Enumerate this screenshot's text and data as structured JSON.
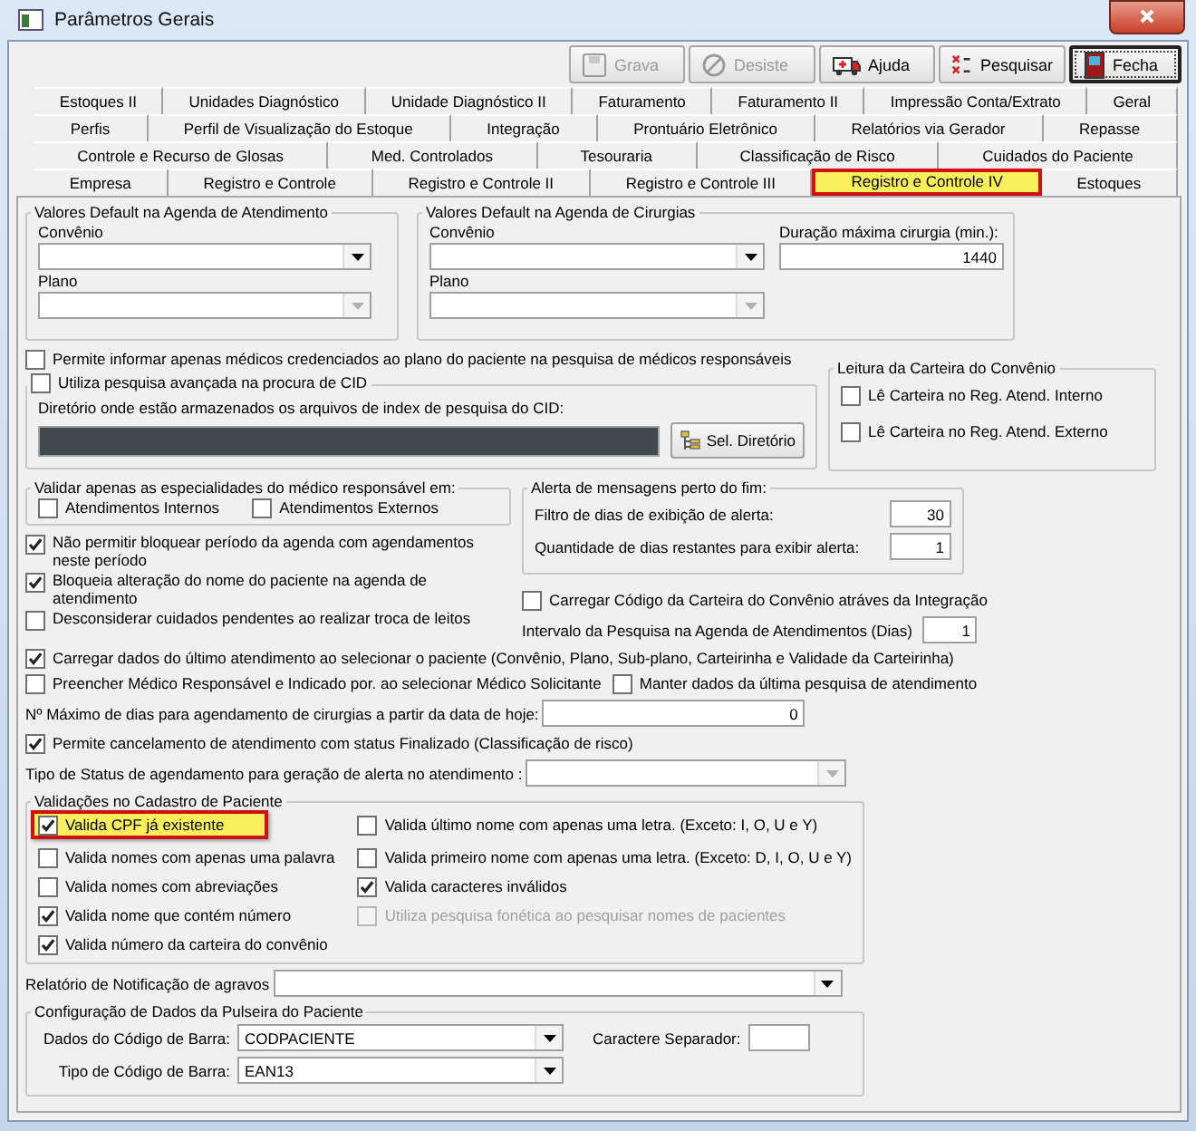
{
  "window": {
    "title": "Parâmetros Gerais"
  },
  "toolbar": [
    {
      "label": "Grava",
      "kind": "save",
      "disabled": true,
      "focused": false
    },
    {
      "label": "Desiste",
      "kind": "cancel",
      "disabled": true,
      "focused": false
    },
    {
      "label": "Ajuda",
      "kind": "help",
      "disabled": false,
      "focused": false
    },
    {
      "label": "Pesquisar",
      "kind": "search",
      "disabled": false,
      "focused": false
    },
    {
      "label": "Fecha",
      "kind": "close",
      "disabled": false,
      "focused": true
    }
  ],
  "tab_rows": [
    [
      {
        "label": "Estoques II",
        "selected": false
      },
      {
        "label": "Unidades Diagnóstico",
        "selected": false
      },
      {
        "label": "Unidade Diagnóstico II",
        "selected": false
      },
      {
        "label": "Faturamento",
        "selected": false
      },
      {
        "label": "Faturamento II",
        "selected": false
      },
      {
        "label": "Impressão Conta/Extrato",
        "selected": false
      },
      {
        "label": "Geral",
        "selected": false
      }
    ],
    [
      {
        "label": "Perfis",
        "selected": false
      },
      {
        "label": "Perfil de Visualização do Estoque",
        "selected": false
      },
      {
        "label": "Integração",
        "selected": false
      },
      {
        "label": "Prontuário Eletrônico",
        "selected": false
      },
      {
        "label": "Relatórios via Gerador",
        "selected": false
      },
      {
        "label": "Repasse",
        "selected": false
      }
    ],
    [
      {
        "label": "Controle e Recurso de Glosas",
        "selected": false
      },
      {
        "label": "Med. Controlados",
        "selected": false
      },
      {
        "label": "Tesouraria",
        "selected": false
      },
      {
        "label": "Classificação de Risco",
        "selected": false
      },
      {
        "label": "Cuidados do Paciente",
        "selected": false
      }
    ],
    [
      {
        "label": "Empresa",
        "selected": false
      },
      {
        "label": "Registro e Controle",
        "selected": false
      },
      {
        "label": "Registro e Controle II",
        "selected": false
      },
      {
        "label": "Registro e Controle III",
        "selected": false
      },
      {
        "label": "Registro e Controle IV",
        "selected": true
      },
      {
        "label": "Estoques",
        "selected": false
      }
    ]
  ],
  "atendimento_defaults": {
    "title": "Valores Default na Agenda de Atendimento",
    "convenio": {
      "label": "Convênio",
      "disabled": false
    },
    "plano": {
      "label": "Plano",
      "disabled": true
    }
  },
  "cirurgias_defaults": {
    "title": "Valores Default na Agenda de Cirurgias",
    "convenio": {
      "label": "Convênio",
      "disabled": false
    },
    "plano": {
      "label": "Plano",
      "disabled": true
    },
    "duracao": {
      "label": "Duração máxima cirurgia (min.):",
      "value": "1440"
    }
  },
  "permite_informar": {
    "label": "Permite informar apenas médicos credenciados ao plano do paciente na pesquisa de médicos responsáveis",
    "checked": false
  },
  "cid": {
    "title": {
      "label": "Utiliza pesquisa avançada na procura de CID",
      "checked": false
    },
    "directory_label": "Diretório onde estão armazenados os arquivos de index de pesquisa do CID:",
    "button": "Sel. Diretório"
  },
  "leitura_carteira": {
    "title": "Leitura da Carteira do Convênio",
    "options": [
      {
        "label": "Lê Carteira no Reg. Atend. Interno",
        "checked": false
      },
      {
        "label": "Lê Carteira no Reg. Atend. Externo",
        "checked": false
      }
    ]
  },
  "validar_especialidades": {
    "title": "Validar apenas as especialidades do médico responsável em:",
    "options": [
      {
        "label": "Atendimentos Internos",
        "checked": false
      },
      {
        "label": "Atendimentos Externos",
        "checked": false
      }
    ]
  },
  "left_options": [
    {
      "label": "Não permitir bloquear período da agenda com agendamentos neste período",
      "checked": true
    },
    {
      "label": "Bloqueia alteração do nome do paciente na agenda de atendimento",
      "checked": true
    },
    {
      "label": "Desconsiderar cuidados pendentes ao realizar troca de leitos",
      "checked": false
    }
  ],
  "alerta": {
    "title": "Alerta de mensagens perto do fim:",
    "fields": [
      {
        "label": "Filtro de dias de exibição de alerta:",
        "value": "30"
      },
      {
        "label": "Quantidade de dias restantes para exibir alerta:",
        "value": "1"
      }
    ]
  },
  "carregar_codigo": {
    "label": "Carregar Código da Carteira do Convênio atráves da Integração",
    "checked": false
  },
  "intervalo": {
    "label": "Intervalo da Pesquisa na Agenda de Atendimentos (Dias)",
    "value": "1"
  },
  "carregar_dados": {
    "label": "Carregar dados do último atendimento ao selecionar o paciente (Convênio, Plano, Sub-plano, Carteirinha e Validade da Carteirinha)",
    "checked": true
  },
  "preencher": {
    "label": "Preencher Médico Responsável e Indicado por. ao selecionar Médico Solicitante",
    "checked": false
  },
  "manter": {
    "label": "Manter dados da última pesquisa de atendimento",
    "checked": false
  },
  "max_dias": {
    "label": "Nº Máximo de dias para agendamento de cirurgias a partir da data de hoje:",
    "value": "0"
  },
  "permite_cancelamento": {
    "label": "Permite cancelamento de atendimento com status Finalizado (Classificação de risco)",
    "checked": true
  },
  "tipo_status": {
    "label": "Tipo de Status de agendamento para geração de alerta no atendimento :",
    "disabled": true
  },
  "validacoes": {
    "title": "Validações no Cadastro de Paciente",
    "columns": [
      [
        {
          "label": "Valida CPF já existente",
          "checked": true,
          "disabled": false,
          "highlighted": true
        },
        {
          "label": "Valida nomes com apenas uma palavra",
          "checked": false,
          "disabled": false,
          "highlighted": false
        },
        {
          "label": "Valida nomes com abreviações",
          "checked": false,
          "disabled": false,
          "highlighted": false
        },
        {
          "label": "Valida nome que contém número",
          "checked": true,
          "disabled": false,
          "highlighted": false
        },
        {
          "label": "Valida número da carteira do convênio",
          "checked": true,
          "disabled": false,
          "highlighted": false
        }
      ],
      [
        {
          "label": "Valida último nome com apenas uma letra. (Exceto: I, O, U e Y)",
          "checked": false,
          "disabled": false,
          "highlighted": false
        },
        {
          "label": "Valida primeiro nome com apenas uma letra. (Exceto: D, I, O, U e Y)",
          "checked": false,
          "disabled": false,
          "highlighted": false
        },
        {
          "label": "Valida caracteres inválidos",
          "checked": true,
          "disabled": false,
          "highlighted": false
        },
        {
          "label": "Utiliza pesquisa fonética ao pesquisar nomes de pacientes",
          "checked": false,
          "disabled": true,
          "highlighted": false
        }
      ]
    ]
  },
  "relatorio": {
    "label": "Relatório de Notificação de agravos",
    "disabled": false
  },
  "pulseira": {
    "title": "Configuração de Dados da Pulseira do Paciente",
    "dados": {
      "label": "Dados do Código de Barra:",
      "value": "CODPACIENTE"
    },
    "separador": {
      "label": "Caractere Separador:"
    },
    "tipo": {
      "label": "Tipo de Código de Barra:",
      "value": "EAN13"
    }
  }
}
